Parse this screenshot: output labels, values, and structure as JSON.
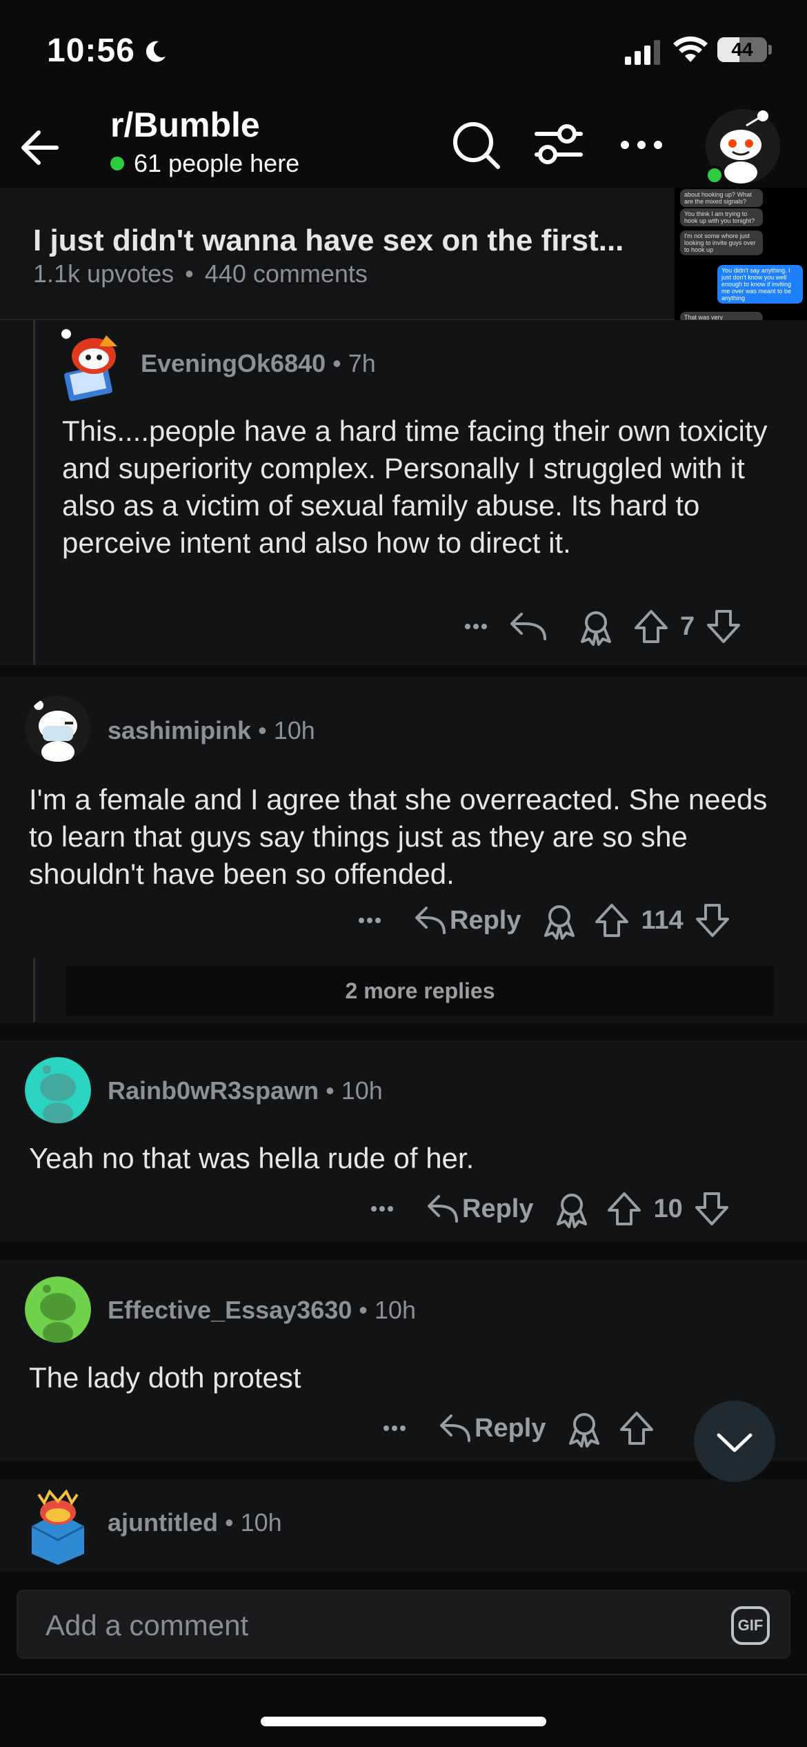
{
  "status": {
    "time": "10:56",
    "battery": "44",
    "battery_level": 0.44
  },
  "header": {
    "subreddit": "r/Bumble",
    "online_count": "61 people here"
  },
  "post": {
    "title": "I just didn't wanna have sex on the first...",
    "upvotes": "1.1k upvotes",
    "separator": "•",
    "comments": "440 comments",
    "thumbnail_messages": [
      "about hooking up? What are the mixed signals?",
      "You think I am trying to hook up with you tonight?",
      "I'm not some whore just looking to invite guys over to hook up",
      "You didn't say anything. I just don't know you well enough to know if inviting me over was meant to be anything",
      "That was very"
    ]
  },
  "comments": [
    {
      "user": "EveningOk6840",
      "time": "• 7h",
      "body": "This....people have a hard time facing their own toxicity and superiority complex. Personally I struggled with it also as a victim of sexual family abuse. Its hard to perceive intent and also how to direct it.",
      "votes": "7"
    },
    {
      "user": "sashimipink",
      "time": "• 10h",
      "body": "I'm a female and I agree that she overreacted. She needs to learn that guys say things just as they are so she shouldn't have been so offended.",
      "reply_label": "Reply",
      "votes": "114",
      "more_replies": "2 more replies"
    },
    {
      "user": "Rainb0wR3spawn",
      "time": "• 10h",
      "body": "Yeah no that was hella rude of her.",
      "reply_label": "Reply",
      "votes": "10"
    },
    {
      "user": "Effective_Essay3630",
      "time": "• 10h",
      "body": "The lady doth protest",
      "reply_label": "Reply"
    },
    {
      "user": "ajuntitled",
      "time": "• 10h"
    }
  ],
  "composer": {
    "placeholder": "Add a comment",
    "gif_label": "GIF"
  },
  "colors": {
    "accent_online": "#2ecc40",
    "teal_avatar": "#2ad4c0",
    "green_avatar": "#6fd24a",
    "blue_bubble": "#1e80ff"
  }
}
